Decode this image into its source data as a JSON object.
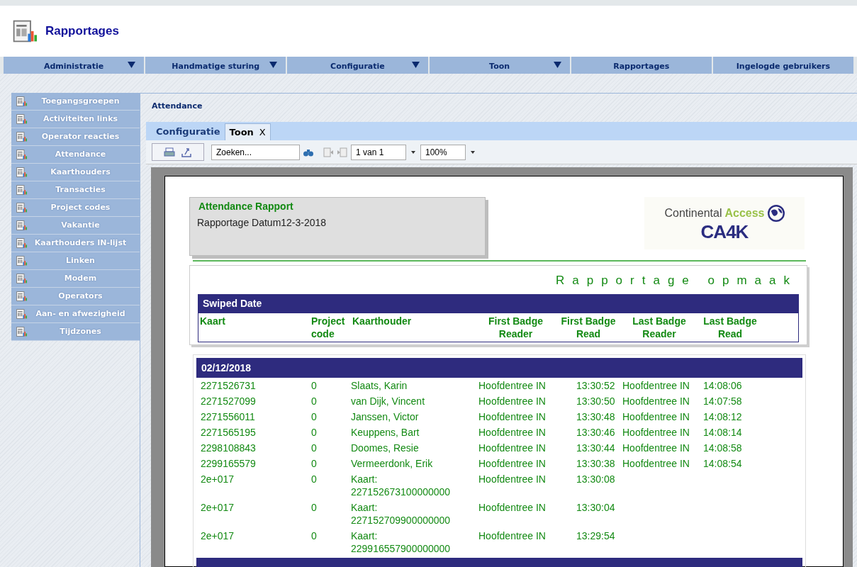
{
  "header": {
    "title": "Rapportages"
  },
  "nav": [
    {
      "label": "Administratie",
      "dropdown": true
    },
    {
      "label": "Handmatige sturing",
      "dropdown": true
    },
    {
      "label": "Configuratie",
      "dropdown": true
    },
    {
      "label": "Toon",
      "dropdown": true
    },
    {
      "label": "Rapportages",
      "dropdown": false
    },
    {
      "label": "Ingelogde gebruikers",
      "dropdown": false
    }
  ],
  "sidebar": {
    "items": [
      "Toegangsgroepen",
      "Activiteiten links",
      "Operator reacties",
      "Attendance",
      "Kaarthouders",
      "Transacties",
      "Project codes",
      "Vakantie",
      "Kaarthouders IN-lijst",
      "Linken",
      "Modem",
      "Operators",
      "Aan- en afwezigheid",
      "Tijdzones"
    ]
  },
  "panel": {
    "title": "Attendance",
    "tabs": [
      {
        "label": "Configuratie",
        "selected": false
      },
      {
        "label": "Toon",
        "selected": true,
        "close": "X"
      }
    ],
    "toolbar": {
      "search_placeholder": "Zoeken...",
      "page": "1 van 1",
      "zoom": "100%"
    }
  },
  "report": {
    "title": "Attendance Rapport",
    "date_line": "Rapportage Datum12-3-2018",
    "logo": {
      "line1_a": "Continental",
      "line1_b": "Access",
      "line2": "CA4K"
    },
    "layout_heading": "Rapportage opmaak",
    "group_label": "Swiped Date",
    "columns": [
      "Kaart",
      "Project code",
      "Kaarthouder",
      "First Badge Reader",
      "First Badge Read",
      "Last Badge Reader",
      "Last Badge Read"
    ],
    "groups": [
      {
        "date": "02/12/2018",
        "rows": [
          {
            "card": "2271526731",
            "project": "0",
            "holder": "Slaats, Karin",
            "first_reader": "Hoofdentree IN",
            "first_time": "13:30:52",
            "last_reader": "Hoofdentree IN",
            "last_time": "14:08:06"
          },
          {
            "card": "2271527099",
            "project": "0",
            "holder": "van Dijk, Vincent",
            "first_reader": "Hoofdentree IN",
            "first_time": "13:30:50",
            "last_reader": "Hoofdentree IN",
            "last_time": "14:07:58"
          },
          {
            "card": "2271556011",
            "project": "0",
            "holder": "Janssen, Victor",
            "first_reader": "Hoofdentree IN",
            "first_time": "13:30:48",
            "last_reader": "Hoofdentree IN",
            "last_time": "14:08:12"
          },
          {
            "card": "2271565195",
            "project": "0",
            "holder": "Keuppens, Bart",
            "first_reader": "Hoofdentree IN",
            "first_time": "13:30:46",
            "last_reader": "Hoofdentree IN",
            "last_time": "14:08:14"
          },
          {
            "card": "2298108843",
            "project": "0",
            "holder": "Doomes, Resie",
            "first_reader": "Hoofdentree IN",
            "first_time": "13:30:44",
            "last_reader": "Hoofdentree IN",
            "last_time": "14:08:58"
          },
          {
            "card": "2299165579",
            "project": "0",
            "holder": "Vermeerdonk, Erik",
            "first_reader": "Hoofdentree IN",
            "first_time": "13:30:38",
            "last_reader": "Hoofdentree IN",
            "last_time": "14:08:54"
          },
          {
            "card": "2e+017",
            "project": "0",
            "holder": "Kaart: 227152673100000000",
            "first_reader": "Hoofdentree IN",
            "first_time": "13:30:08"
          },
          {
            "card": "2e+017",
            "project": "0",
            "holder": "Kaart: 227152709900000000",
            "first_reader": "Hoofdentree IN",
            "first_time": "13:30:04"
          },
          {
            "card": "2e+017",
            "project": "0",
            "holder": "Kaart: 229916557900000000",
            "first_reader": "Hoofdentree IN",
            "first_time": "13:29:54"
          }
        ]
      }
    ],
    "more_groups_below": true
  }
}
